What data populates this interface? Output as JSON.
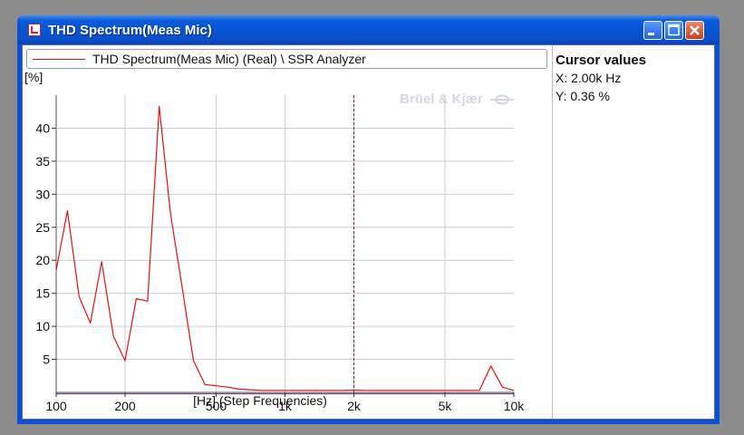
{
  "window": {
    "title": "THD Spectrum(Meas Mic)",
    "icon": "analyzer-app-icon",
    "buttons": [
      "minimize",
      "maximize",
      "close"
    ]
  },
  "legend": {
    "label": "THD Spectrum(Meas Mic) (Real) \\ SSR Analyzer",
    "color": "#e81010"
  },
  "watermark": "Brüel & Kjær",
  "cursor_panel": {
    "title": "Cursor values",
    "x": "X: 2.00k Hz",
    "y": "Y: 0.36 %"
  },
  "chart_data": {
    "type": "line",
    "title": "",
    "ylabel": "[%]",
    "xlabel": "[Hz] (Step Frequencies)",
    "xscale": "log",
    "xlim": [
      100,
      10000
    ],
    "ylim": [
      0,
      45
    ],
    "xticks": [
      100,
      200,
      500,
      1000,
      2000,
      5000,
      10000
    ],
    "xtick_labels": [
      "100",
      "200",
      "500",
      "1k",
      "2k",
      "5k",
      "10k"
    ],
    "yticks": [
      5,
      10,
      15,
      20,
      25,
      30,
      35,
      40
    ],
    "ytick_labels": [
      "5",
      "10",
      "15",
      "20",
      "25",
      "30",
      "35",
      "40"
    ],
    "grid": true,
    "cursor_x": 2000,
    "series": [
      {
        "name": "THD Spectrum(Meas Mic) (Real) \\ SSR Analyzer",
        "color": "#e81010",
        "x": [
          100,
          112,
          126,
          141,
          158,
          178,
          200,
          224,
          251,
          282,
          316,
          355,
          398,
          447,
          501,
          562,
          631,
          708,
          794,
          891,
          1000,
          1122,
          1259,
          1413,
          1585,
          1778,
          1995,
          2239,
          2512,
          2818,
          3162,
          3548,
          3981,
          4467,
          5012,
          5623,
          6310,
          7079,
          7943,
          8913,
          10000
        ],
        "y": [
          18.5,
          27.5,
          14.5,
          10.5,
          19.8,
          8.5,
          4.8,
          14.2,
          13.8,
          43.3,
          27,
          16,
          4.8,
          1.2,
          1.0,
          0.8,
          0.5,
          0.4,
          0.3,
          0.3,
          0.3,
          0.3,
          0.3,
          0.3,
          0.3,
          0.3,
          0.36,
          0.3,
          0.3,
          0.3,
          0.3,
          0.3,
          0.3,
          0.3,
          0.3,
          0.3,
          0.3,
          0.3,
          4.0,
          0.8,
          0.3
        ]
      }
    ]
  }
}
